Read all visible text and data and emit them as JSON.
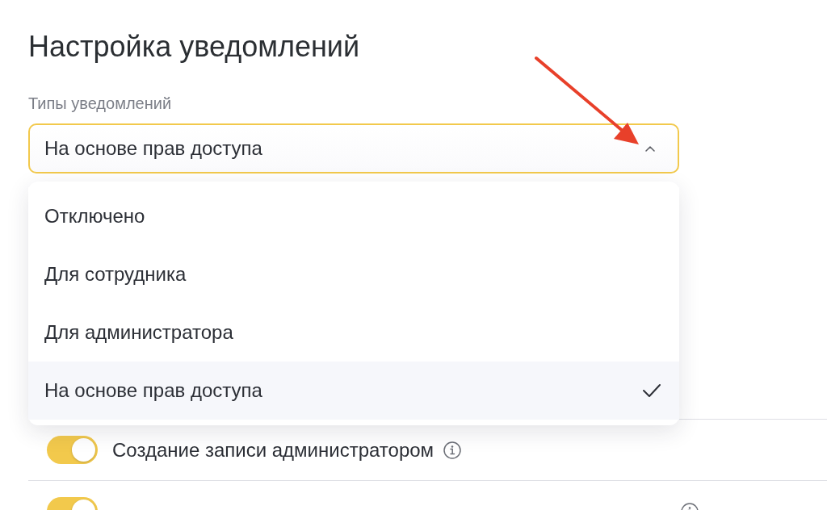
{
  "title": "Настройка уведомлений",
  "notification_types": {
    "label": "Типы уведомлений",
    "value": "На основе прав доступа",
    "expanded": true,
    "options": [
      {
        "label": "Отключено",
        "selected": false
      },
      {
        "label": "Для сотрудника",
        "selected": false
      },
      {
        "label": "Для администратора",
        "selected": false
      },
      {
        "label": "На основе прав доступа",
        "selected": true
      }
    ]
  },
  "settings": [
    {
      "label": "Создание записи администратором",
      "on": true
    },
    {
      "on": true
    }
  ]
}
